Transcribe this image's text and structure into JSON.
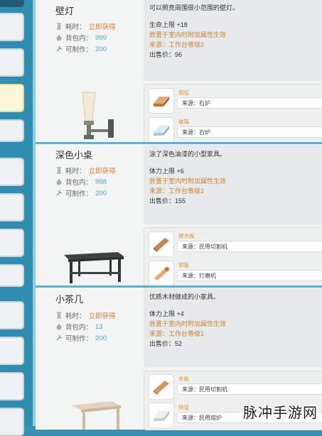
{
  "items": [
    {
      "name": "壁灯",
      "time_label": "耗时：",
      "time_value": "立即获得",
      "bag_label": "背包内：",
      "bag_value": "999",
      "craft_label": "可制作：",
      "craft_value": "200",
      "desc_lines": [
        "可以照亮周围很小范围的壁灯。"
      ],
      "stat_line": "生命上限 +18",
      "effect_line": "放置于室内时附加属性生效",
      "source_line": "来源：工作台等级2",
      "price_line": "出售价：96",
      "materials": [
        {
          "name": "铜锭",
          "source": "来源：石炉",
          "icon": "copper-ingot-icon"
        },
        {
          "name": "玻璃",
          "source": "来源：石炉",
          "icon": "glass-icon"
        }
      ]
    },
    {
      "name": "深色小桌",
      "time_label": "耗时：",
      "time_value": "立即获得",
      "bag_label": "背包内：",
      "bag_value": "998",
      "craft_label": "可制作：",
      "craft_value": "200",
      "desc_lines": [
        "涂了深色油漆的小型家具。"
      ],
      "stat_line": "体力上限 +6",
      "effect_line": "放置于室内时附加属性生效",
      "source_line": "来源：工作台等级2",
      "price_line": "出售价：155",
      "materials": [
        {
          "name": "硬木板",
          "source": "来源：民用切割机",
          "icon": "hardwood-plank-icon"
        },
        {
          "name": "铜管",
          "source": "来源：打磨机",
          "icon": "copper-pipe-icon"
        }
      ]
    },
    {
      "name": "小茶几",
      "time_label": "耗时：",
      "time_value": "立即获得",
      "bag_label": "背包内：",
      "bag_value": "13",
      "craft_label": "可制作：",
      "craft_value": "200",
      "desc_lines": [
        "优质木材做成的小家具。"
      ],
      "stat_line": "体力上限 +4",
      "effect_line": "放置于室内时附加属性生效",
      "source_line": "来源：工作台等级1",
      "price_line": "出售价：52",
      "materials": [
        {
          "name": "木板",
          "source": "来源：民用切割机",
          "icon": "wood-plank-icon"
        },
        {
          "name": "铁锭",
          "source": "来源：民用熔炉",
          "icon": "iron-ingot-icon"
        }
      ]
    }
  ],
  "watermark": "脉冲手游网"
}
